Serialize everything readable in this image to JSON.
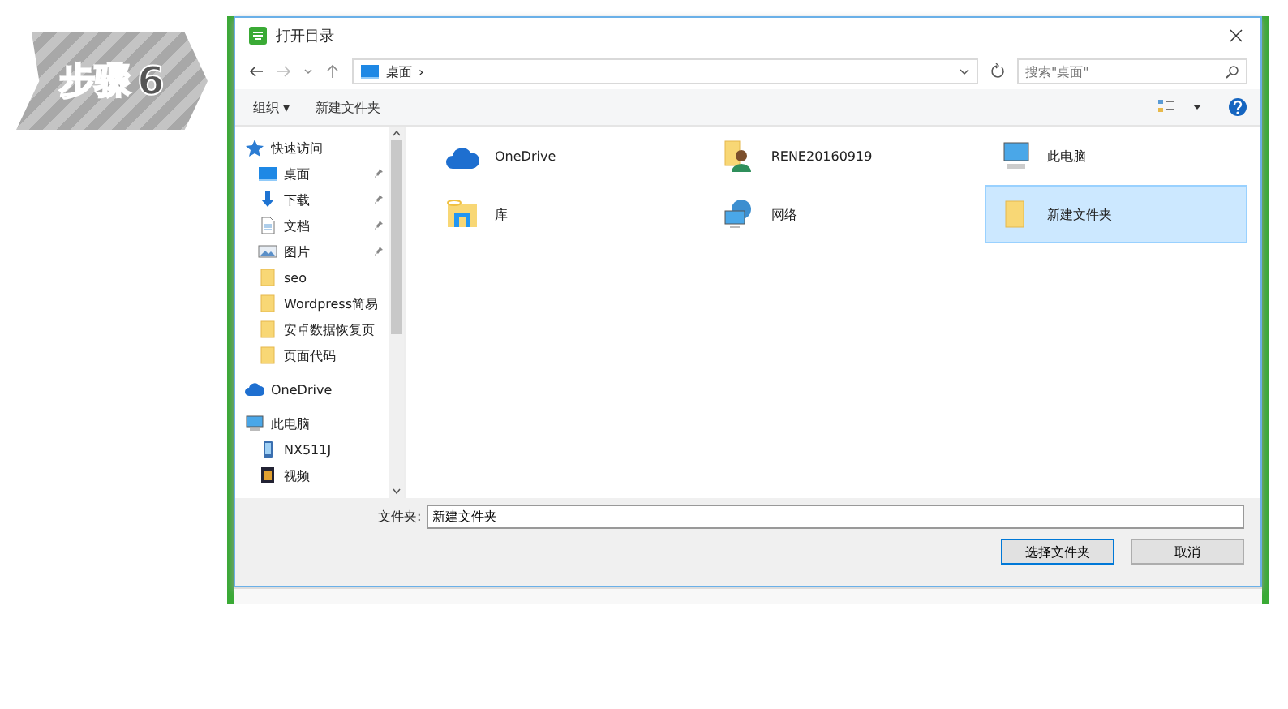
{
  "step_badge": {
    "label": "步骤",
    "number": "6"
  },
  "window": {
    "title": "打开目录"
  },
  "address_bar": {
    "path": "桌面",
    "separator": "›"
  },
  "search": {
    "placeholder": "搜索\"桌面\""
  },
  "toolbar": {
    "organize": "组织 ▾",
    "new_folder": "新建文件夹"
  },
  "sidebar": {
    "items": [
      {
        "label": "快速访问",
        "kind": "star",
        "pinned": false,
        "indent": false
      },
      {
        "label": "桌面",
        "kind": "desktop",
        "pinned": true,
        "indent": true
      },
      {
        "label": "下载",
        "kind": "download",
        "pinned": true,
        "indent": true
      },
      {
        "label": "文档",
        "kind": "document",
        "pinned": true,
        "indent": true
      },
      {
        "label": "图片",
        "kind": "picture",
        "pinned": true,
        "indent": true
      },
      {
        "label": "seo",
        "kind": "folder",
        "pinned": false,
        "indent": true
      },
      {
        "label": "Wordpress简易",
        "kind": "folder",
        "pinned": false,
        "indent": true
      },
      {
        "label": "安卓数据恢复页",
        "kind": "folder",
        "pinned": false,
        "indent": true
      },
      {
        "label": "页面代码",
        "kind": "folder",
        "pinned": false,
        "indent": true
      },
      {
        "label": "OneDrive",
        "kind": "cloud",
        "pinned": false,
        "indent": false
      },
      {
        "label": "此电脑",
        "kind": "computer",
        "pinned": false,
        "indent": false
      },
      {
        "label": "NX511J",
        "kind": "phone",
        "pinned": false,
        "indent": true
      },
      {
        "label": "视频",
        "kind": "video",
        "pinned": false,
        "indent": true
      }
    ]
  },
  "items": [
    {
      "label": "OneDrive",
      "kind": "cloud",
      "selected": false
    },
    {
      "label": "RENE20160919",
      "kind": "user",
      "selected": false
    },
    {
      "label": "此电脑",
      "kind": "computer",
      "selected": false
    },
    {
      "label": "库",
      "kind": "library",
      "selected": false
    },
    {
      "label": "网络",
      "kind": "network",
      "selected": false
    },
    {
      "label": "新建文件夹",
      "kind": "folder",
      "selected": true
    }
  ],
  "folder_field": {
    "label": "文件夹:",
    "value": "新建文件夹"
  },
  "buttons": [
    {
      "label": "选择文件夹",
      "default": true
    },
    {
      "label": "取消",
      "default": false
    }
  ]
}
